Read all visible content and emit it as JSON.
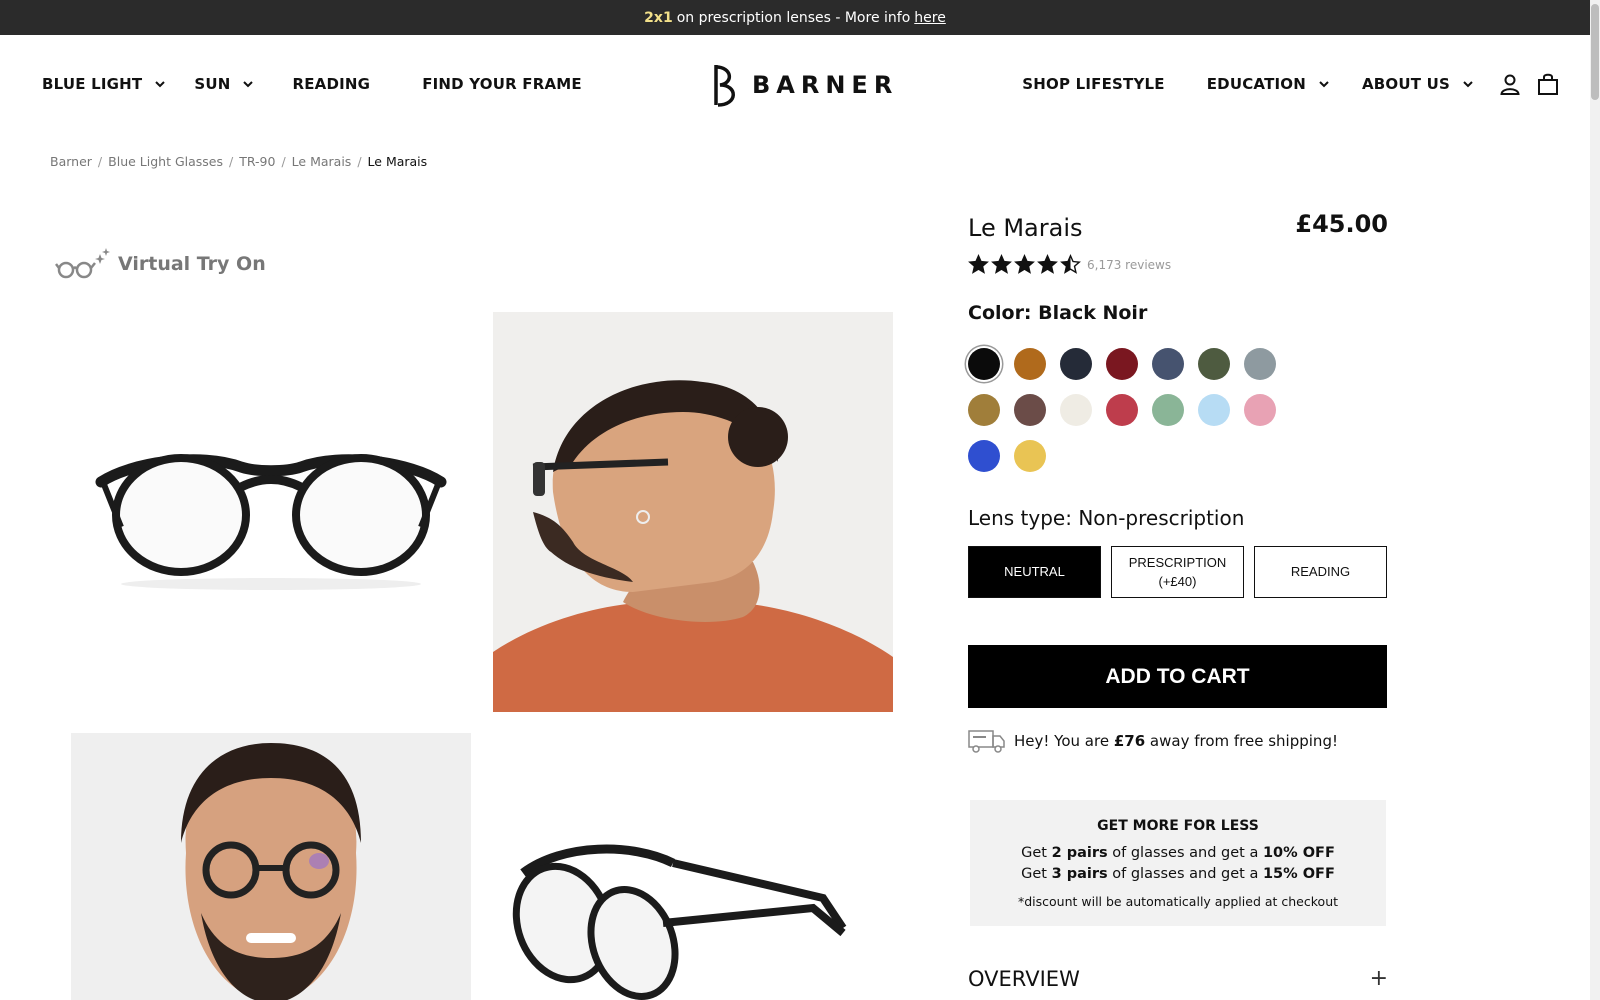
{
  "announcement": {
    "highlight": "2x1",
    "text": "on prescription lenses - More info",
    "link": "here"
  },
  "nav": {
    "left": [
      {
        "label": "BLUE LIGHT",
        "has_dropdown": true
      },
      {
        "label": "SUN",
        "has_dropdown": true
      },
      {
        "label": "READING",
        "has_dropdown": false
      },
      {
        "label": "FIND YOUR FRAME",
        "has_dropdown": false
      }
    ],
    "right": [
      {
        "label": "SHOP LIFESTYLE",
        "has_dropdown": false
      },
      {
        "label": "EDUCATION",
        "has_dropdown": true
      },
      {
        "label": "ABOUT US",
        "has_dropdown": true
      }
    ],
    "logo_text": "BARNER",
    "icons": [
      "account-icon",
      "cart-icon"
    ]
  },
  "breadcrumb": [
    "Barner",
    "Blue Light Glasses",
    "TR-90",
    "Le Marais",
    "Le Marais"
  ],
  "gallery": {
    "virtual_try_on": "Virtual Try On",
    "images": [
      "glasses-front-photo",
      "model-profile-photo",
      "model-front-photo",
      "glasses-angle-photo"
    ]
  },
  "product": {
    "name": "Le Marais",
    "price": "£45.00",
    "rating": 4.5,
    "reviews": "6,173 reviews",
    "color_label": "Color: Black Noir",
    "swatches": [
      "#0b0b0b",
      "#b06a1c",
      "#252b38",
      "#7a1720",
      "#46536f",
      "#4e5b40",
      "#8e9aa0",
      "#a07e3a",
      "#6b4c48",
      "#efece4",
      "#be3d4c",
      "#8ab597",
      "#b7dcf4",
      "#e8a2b4",
      "#2f4fd0",
      "#e9c454"
    ],
    "selected_swatch": 0,
    "lens_label": "Lens type: Non-prescription",
    "lens_options": [
      {
        "label": "NEUTRAL",
        "sub": ""
      },
      {
        "label": "PRESCRIPTION",
        "sub": "(+£40)"
      },
      {
        "label": "READING",
        "sub": ""
      }
    ],
    "selected_lens": 0,
    "add_to_cart": "ADD TO CART",
    "shipping": {
      "before": "Hey! You are",
      "amount": "£76",
      "after": "away from free shipping!"
    },
    "promo": {
      "heading": "GET MORE FOR LESS",
      "line1": {
        "a": "Get",
        "b": "2 pairs",
        "c": "of glasses and get a",
        "d": "10% OFF"
      },
      "line2": {
        "a": "Get",
        "b": "3 pairs",
        "c": "of glasses and get a",
        "d": "15% OFF"
      },
      "note": "*discount will be automatically applied at checkout"
    },
    "overview": "OVERVIEW"
  }
}
